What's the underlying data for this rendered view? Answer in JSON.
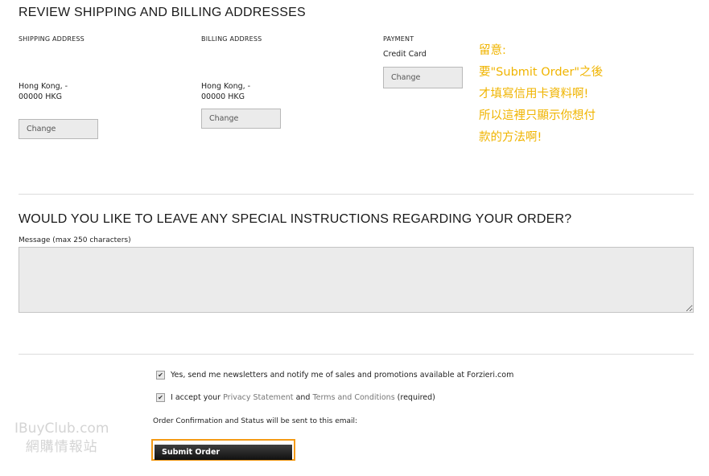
{
  "review": {
    "title": "REVIEW SHIPPING AND BILLING ADDRESSES",
    "shipping": {
      "heading": "SHIPPING ADDRESS",
      "line1": "Hong Kong, -",
      "line2": "00000 HKG",
      "change_label": "Change"
    },
    "billing": {
      "heading": "BILLING ADDRESS",
      "line1": "Hong Kong, -",
      "line2": "00000 HKG",
      "change_label": "Change"
    },
    "payment": {
      "heading": "PAYMENT",
      "method": "Credit Card",
      "change_label": "Change"
    }
  },
  "annotation": {
    "lines": [
      "留意:",
      "要\"Submit Order\"之後",
      "才填寫信用卡資料啊!",
      "所以這裡只顯示你想付",
      "款的方法啊!"
    ],
    "color": "#f0b400"
  },
  "instructions": {
    "title": "WOULD YOU LIKE TO LEAVE ANY SPECIAL INSTRUCTIONS REGARDING YOUR ORDER?",
    "label": "Message (max 250 characters)",
    "value": ""
  },
  "consent": {
    "newsletter": {
      "checked": true,
      "text": "Yes, send me newsletters and notify me of sales and promotions available at Forzieri.com"
    },
    "terms": {
      "checked": true,
      "prefix": "I accept your",
      "privacy_link": "Privacy Statement",
      "and": "and",
      "terms_link": "Terms and Conditions",
      "suffix": "(required)"
    },
    "confirmation_note": "Order Confirmation and Status will be sent to this email:"
  },
  "submit": {
    "label": "Submit Order",
    "highlight_color": "#f49a14"
  },
  "watermark": {
    "line1": "IBuyClub.com",
    "line2": "網購情報站"
  }
}
